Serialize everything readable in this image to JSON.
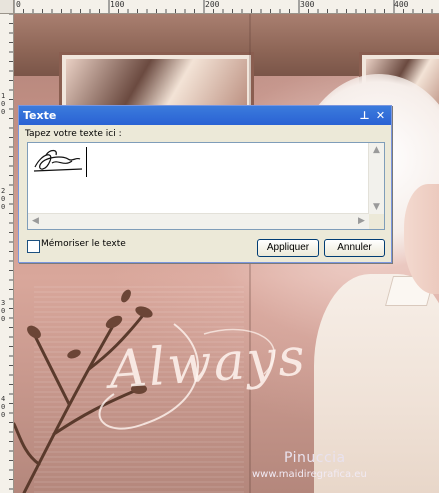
{
  "ruler": {
    "top_labels": [
      "0",
      "100",
      "200",
      "300",
      "400"
    ],
    "left_labels": [
      "1",
      "0",
      "0",
      "2",
      "0",
      "0",
      "3",
      "0",
      "0",
      "4",
      "0",
      "0"
    ]
  },
  "dialog": {
    "title": "Texte",
    "pin_icon": "⊥",
    "close_icon": "✕",
    "prompt": "Tapez votre texte ici :",
    "remember_label": "Mémoriser le texte",
    "remember_checked": false,
    "apply_label": "Appliquer",
    "cancel_label": "Annuler"
  },
  "artwork": {
    "headline": "Always",
    "watermark_name": "Pinuccia",
    "watermark_url": "www.maidiregrafica.eu"
  },
  "colors": {
    "titlebar": "#2a62d4",
    "dialog_bg": "#ece9d8",
    "canvas_rose": "#c79488"
  }
}
